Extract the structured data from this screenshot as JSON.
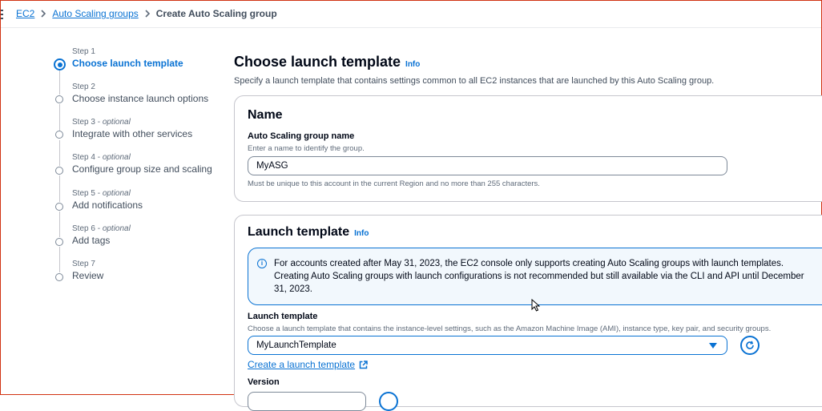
{
  "breadcrumb": {
    "items": [
      "EC2",
      "Auto Scaling groups"
    ],
    "current": "Create Auto Scaling group"
  },
  "steps": [
    {
      "number": "Step 1",
      "optional": "",
      "title": "Choose launch template",
      "active": true
    },
    {
      "number": "Step 2",
      "optional": "",
      "title": "Choose instance launch options",
      "active": false
    },
    {
      "number": "Step 3 - ",
      "optional": "optional",
      "title": "Integrate with other services",
      "active": false
    },
    {
      "number": "Step 4 - ",
      "optional": "optional",
      "title": "Configure group size and scaling",
      "active": false
    },
    {
      "number": "Step 5 - ",
      "optional": "optional",
      "title": "Add notifications",
      "active": false
    },
    {
      "number": "Step 6 - ",
      "optional": "optional",
      "title": "Add tags",
      "active": false
    },
    {
      "number": "Step 7",
      "optional": "",
      "title": "Review",
      "active": false
    }
  ],
  "main": {
    "title": "Choose launch template",
    "info": "Info",
    "description": "Specify a launch template that contains settings common to all EC2 instances that are launched by this Auto Scaling group."
  },
  "name_panel": {
    "title": "Name",
    "field_label": "Auto Scaling group name",
    "field_desc": "Enter a name to identify the group.",
    "value": "MyASG",
    "constraint": "Must be unique to this account in the current Region and no more than 255 characters."
  },
  "template_panel": {
    "title": "Launch template",
    "info": "Info",
    "alert": "For accounts created after May 31, 2023, the EC2 console only supports creating Auto Scaling groups with launch templates. Creating Auto Scaling groups with launch configurations is not recommended but still available via the CLI and API until December 31, 2023.",
    "field_label": "Launch template",
    "field_desc": "Choose a launch template that contains the instance-level settings, such as the Amazon Machine Image (AMI), instance type, key pair, and security groups.",
    "selected": "MyLaunchTemplate",
    "create_link": "Create a launch template",
    "version_label": "Version"
  },
  "colors": {
    "link": "#0972d3",
    "text": "#000716",
    "muted": "#5f6b7a",
    "border": "#c6c6cd",
    "alert_bg": "#f2f8fd"
  }
}
